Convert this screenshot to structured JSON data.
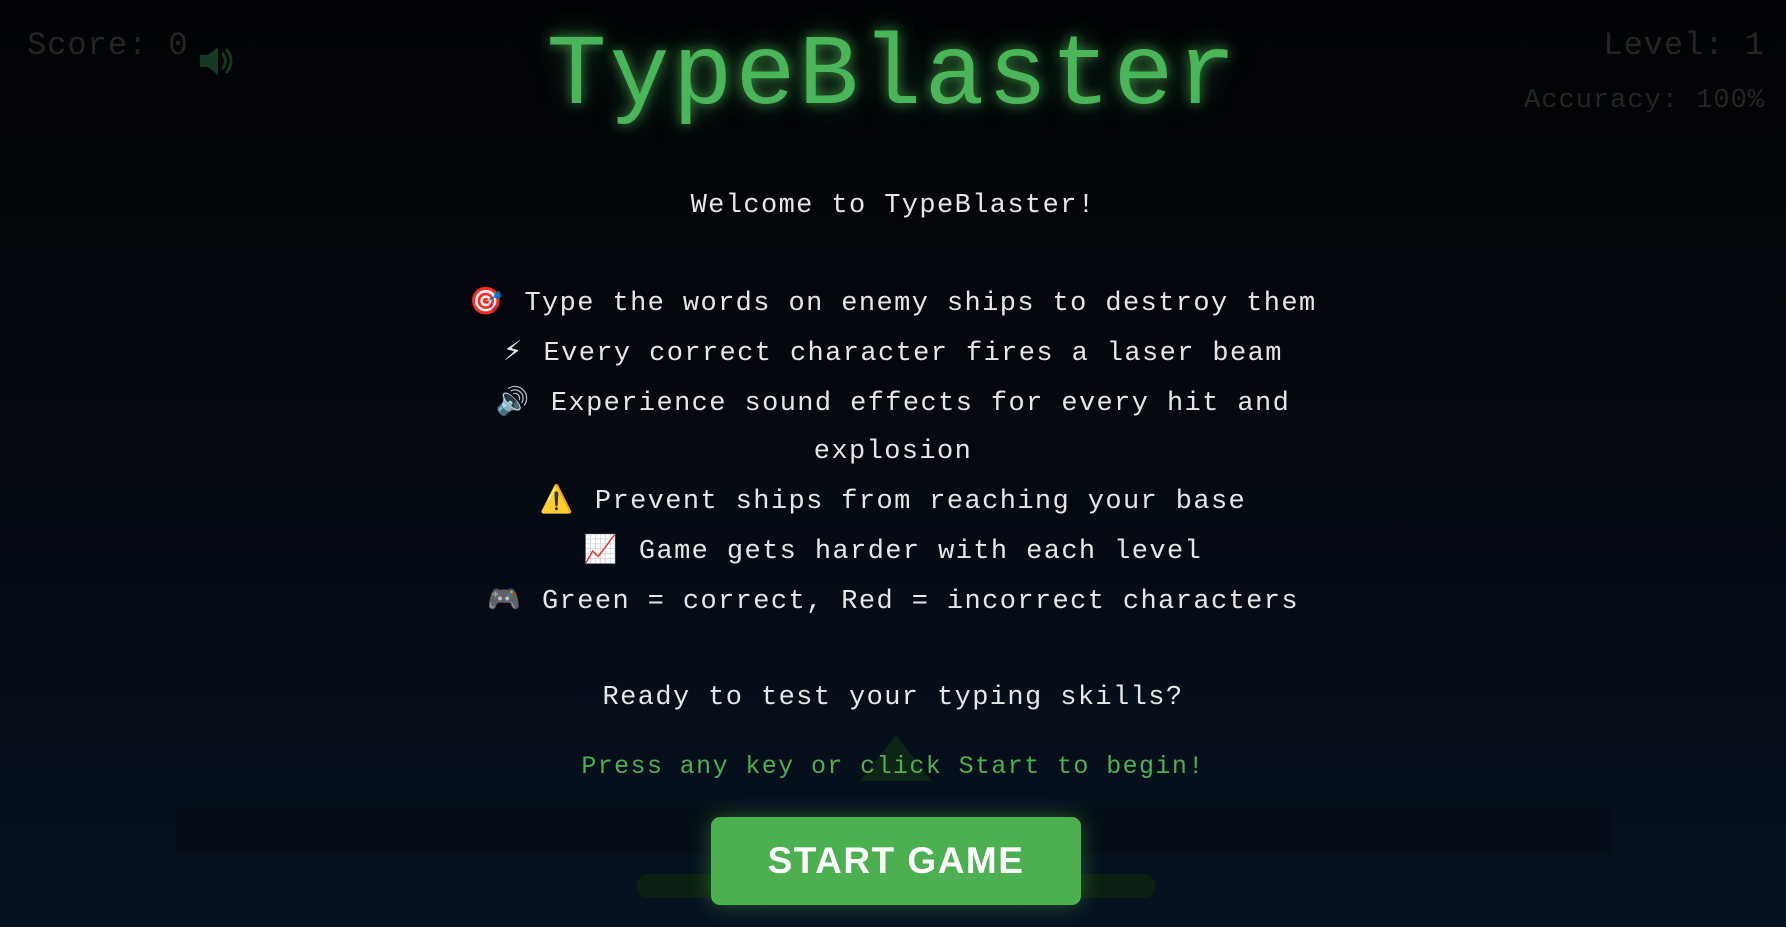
{
  "hud": {
    "score_label": "Score: 0",
    "level_label": "Level: 1",
    "accuracy_label": "Accuracy: 100%",
    "sound_icon": "speaker-icon"
  },
  "title": "TypeBlaster",
  "intro": {
    "welcome": "Welcome to TypeBlaster!",
    "rules": [
      {
        "icon": "🎯",
        "icon_name": "target-icon",
        "text": "Type the words on enemy ships to destroy them"
      },
      {
        "icon": "⚡",
        "icon_name": "lightning-icon",
        "text": "Every correct character fires a laser beam"
      },
      {
        "icon": "🔊",
        "icon_name": "speaker-icon",
        "text": "Experience sound effects for every hit and explosion"
      },
      {
        "icon": "⚠️",
        "icon_name": "warning-icon",
        "text": "Prevent ships from reaching your base"
      },
      {
        "icon": "📈",
        "icon_name": "chart-increasing-icon",
        "text": "Game gets harder with each level"
      },
      {
        "icon": "🎮",
        "icon_name": "game-controller-icon",
        "text": "Green = correct, Red = incorrect characters"
      }
    ],
    "ready": "Ready to test your typing skills?",
    "prompt": "Press any key or click Start to begin!"
  },
  "start_button": {
    "label": "START GAME"
  },
  "colors": {
    "accent_green": "#4caf50",
    "background": "#02050a",
    "text": "#e6e6e6",
    "hud_text": "#1d2a22"
  }
}
